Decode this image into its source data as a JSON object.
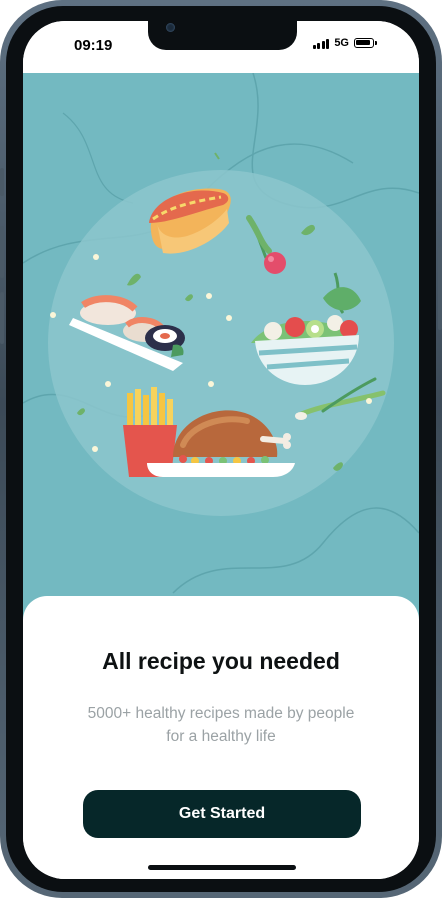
{
  "status_bar": {
    "time": "09:19",
    "network": "5G"
  },
  "onboarding": {
    "title": "All recipe you needed",
    "subtitle": "5000+ healthy recipes made by people for a healthy life",
    "cta_label": "Get Started"
  },
  "colors": {
    "hero_background": "#73b9c1",
    "button_background": "#062729",
    "title_text": "#0e1213",
    "subtitle_text": "#9ba2a5"
  },
  "icons": [
    "signal-icon",
    "battery-icon",
    "front-camera-icon"
  ]
}
